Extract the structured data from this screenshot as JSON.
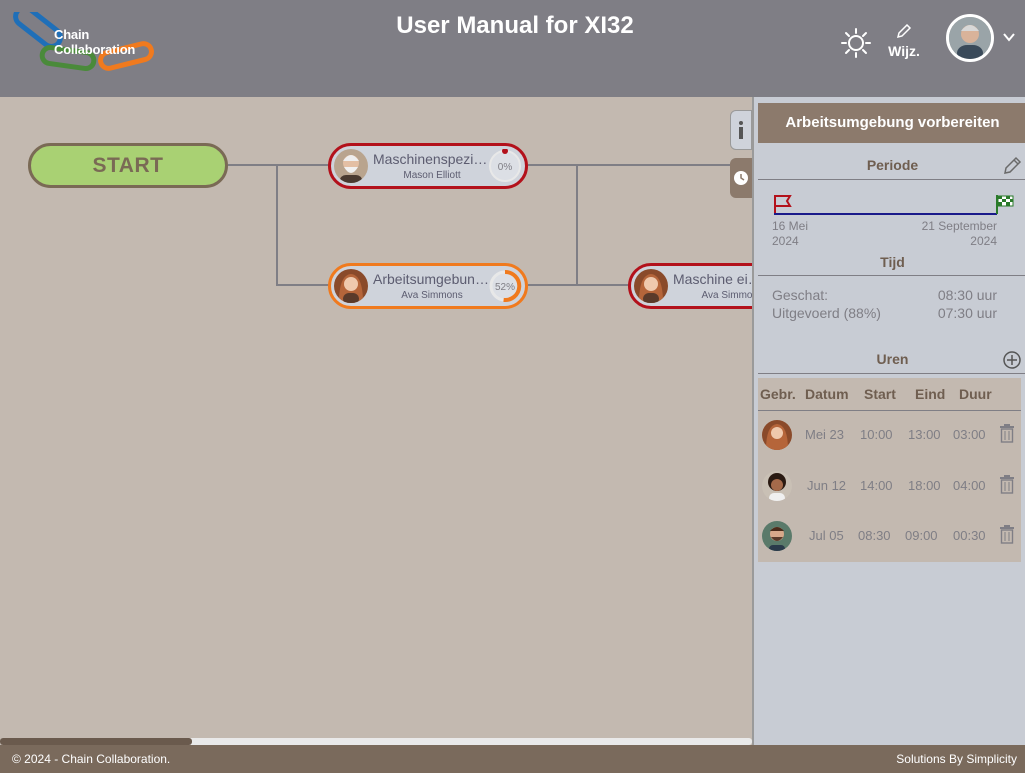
{
  "header": {
    "logo_line1": "Chain",
    "logo_line2": "Collaboration",
    "title": "User Manual for XI32",
    "theme_icon": "sun-icon",
    "edit_label": "Wijz.",
    "user_menu_icon": "chevron-down-icon"
  },
  "canvas": {
    "start_label": "START",
    "tasks": [
      {
        "name": "Maschinenspezi…",
        "user": "Mason Elliott",
        "progress": "0%",
        "progress_value": 0,
        "state_color": "#b3111b"
      },
      {
        "name": "Arbeitsumgebun…",
        "user": "Ava Simmons",
        "progress": "52%",
        "progress_value": 52,
        "state_color": "#f07a1e"
      },
      {
        "name": "Maschine ei…",
        "user": "Ava Simmo…",
        "state_color": "#b3111b"
      }
    ]
  },
  "panel": {
    "title": "Arbeitsumgebung vorbereiten",
    "periode": {
      "label": "Periode",
      "start_day": "16 Mei",
      "start_year": "2024",
      "end_day": "21 September",
      "end_year": "2024"
    },
    "tijd": {
      "label": "Tijd",
      "estimated_label": "Geschat:",
      "estimated_value": "08:30 uur",
      "done_label": "Uitgevoerd (88%)",
      "done_value": "07:30 uur"
    },
    "uren": {
      "label": "Uren",
      "columns": [
        "Gebr.",
        "Datum",
        "Start",
        "Eind",
        "Duur"
      ],
      "rows": [
        {
          "date": "Mei 23",
          "start": "10:00",
          "end": "13:00",
          "duration": "03:00"
        },
        {
          "date": "Jun 12",
          "start": "14:00",
          "end": "18:00",
          "duration": "04:00"
        },
        {
          "date": "Jul 05",
          "start": "08:30",
          "end": "09:00",
          "duration": "00:30"
        }
      ]
    }
  },
  "footer": {
    "left": "© 2024 - Chain Collaboration.",
    "right": "Solutions By Simplicity"
  },
  "colors": {
    "header_bg": "#7f7e85",
    "accent_brown": "#8c7a6c",
    "canvas_bg": "#c3b9b0",
    "start_green": "#a9d173",
    "late_red": "#b3111b",
    "active_orange": "#f07a1e"
  }
}
